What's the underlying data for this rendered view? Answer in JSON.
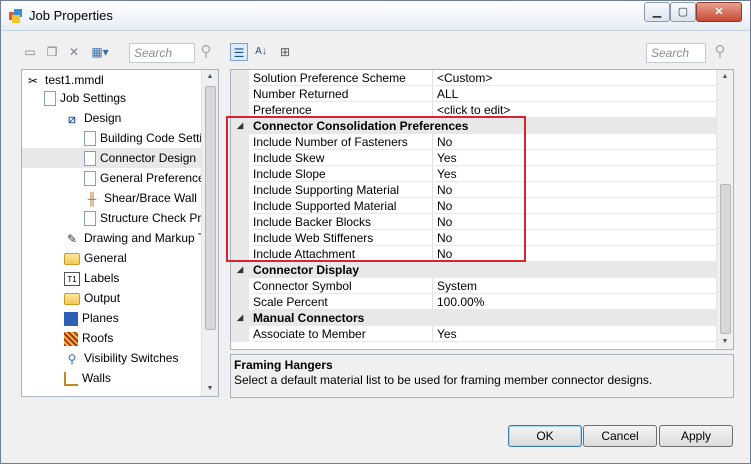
{
  "window": {
    "title": "Job Properties"
  },
  "left_toolbar": {
    "search_placeholder": "Search"
  },
  "right_toolbar": {
    "search_placeholder": "Search"
  },
  "tree": {
    "items": [
      {
        "label": "test1.mmdl",
        "icon": "tools-icon"
      },
      {
        "label": "Job Settings",
        "icon": "settings-page-icon"
      },
      {
        "label": "Design",
        "icon": "design-icon"
      },
      {
        "label": "Building Code Setting",
        "icon": "page-icon"
      },
      {
        "label": "Connector Design",
        "icon": "page-icon"
      },
      {
        "label": "General Preferences",
        "icon": "page-icon"
      },
      {
        "label": "Shear/Brace Wall Lin",
        "icon": "shear-wall-icon"
      },
      {
        "label": "Structure Check Pref",
        "icon": "page-icon"
      },
      {
        "label": "Drawing and Markup Too",
        "icon": "drawing-icon"
      },
      {
        "label": "General",
        "icon": "folder-icon"
      },
      {
        "label": "Labels",
        "icon": "labels-icon"
      },
      {
        "label": "Output",
        "icon": "folder-icon"
      },
      {
        "label": "Planes",
        "icon": "planes-icon"
      },
      {
        "label": "Roofs",
        "icon": "roofs-icon"
      },
      {
        "label": "Visibility Switches",
        "icon": "magnifier-icon"
      },
      {
        "label": "Walls",
        "icon": "walls-icon"
      }
    ]
  },
  "grid": {
    "top_rows": [
      {
        "name": "Solution Preference Scheme",
        "value": "<Custom>"
      },
      {
        "name": "Number Returned",
        "value": "ALL"
      },
      {
        "name": "Preference",
        "value": "<click to edit>"
      }
    ],
    "categories": [
      {
        "title": "Connector Consolidation Preferences",
        "rows": [
          {
            "name": "Include Number of Fasteners",
            "value": "No"
          },
          {
            "name": "Include Skew",
            "value": "Yes"
          },
          {
            "name": "Include Slope",
            "value": "Yes"
          },
          {
            "name": "Include Supporting Material",
            "value": "No"
          },
          {
            "name": "Include Supported Material",
            "value": "No"
          },
          {
            "name": "Include Backer Blocks",
            "value": "No"
          },
          {
            "name": "Include Web Stiffeners",
            "value": "No"
          },
          {
            "name": "Include Attachment",
            "value": "No"
          }
        ]
      },
      {
        "title": "Connector Display",
        "rows": [
          {
            "name": "Connector Symbol",
            "value": "System"
          },
          {
            "name": "Scale Percent",
            "value": "100.00%"
          }
        ]
      },
      {
        "title": "Manual Connectors",
        "rows": [
          {
            "name": "Associate to Member",
            "value": "Yes"
          }
        ]
      }
    ]
  },
  "description": {
    "title": "Framing Hangers",
    "text": "Select a default material list to be used for framing member connector designs."
  },
  "buttons": {
    "ok": "OK",
    "cancel": "Cancel",
    "apply": "Apply"
  },
  "colors": {
    "highlight": "#d9232f",
    "accent": "#3c7fb1"
  }
}
